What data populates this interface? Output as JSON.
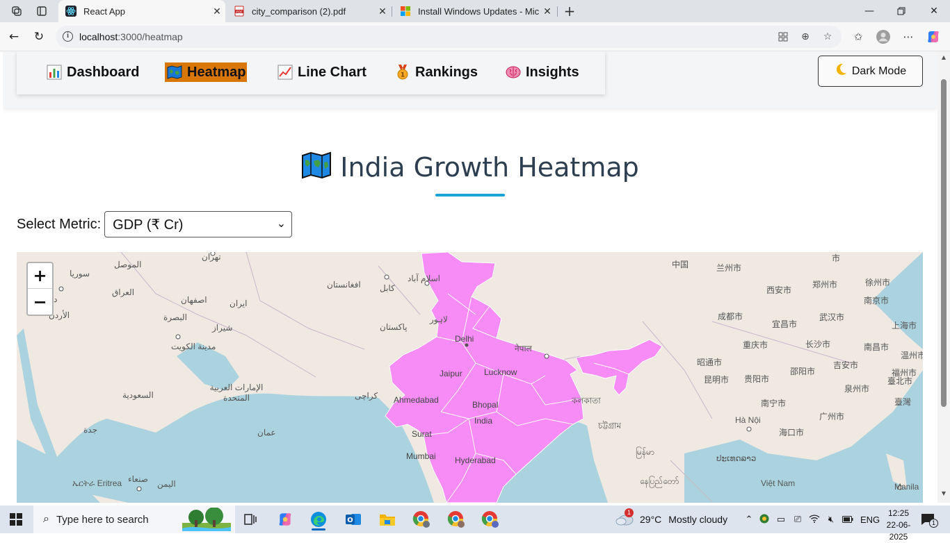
{
  "browser": {
    "tabs": [
      {
        "title": "React App",
        "active": true
      },
      {
        "title": "city_comparison (2).pdf",
        "active": false
      },
      {
        "title": "Install Windows Updates - Micros",
        "active": false
      }
    ],
    "url_host": "localhost",
    "url_path": ":3000/heatmap"
  },
  "nav": {
    "items": [
      {
        "label": "Dashboard",
        "icon": "bar-chart-icon"
      },
      {
        "label": "Heatmap",
        "icon": "map-icon"
      },
      {
        "label": "Line Chart",
        "icon": "line-chart-icon"
      },
      {
        "label": "Rankings",
        "icon": "medal-icon"
      },
      {
        "label": "Insights",
        "icon": "brain-icon"
      }
    ],
    "active_item": "Heatmap",
    "active_color": "#d97706",
    "dark_mode_label": "Dark Mode"
  },
  "page": {
    "title": "India Growth Heatmap",
    "accent_color": "#1aa3d6",
    "metric_label": "Select Metric:",
    "metric_selected": "GDP (₹ Cr)"
  },
  "map": {
    "highlight_color": "#f78cf7",
    "zoom_in": "+",
    "zoom_out": "−",
    "labels": {
      "mosul": "الموصل",
      "tehran": "تهران",
      "syria": "سوريا",
      "afghanistan": "افغانستان",
      "kabul": "كابل",
      "islamabad": "اسلام آباد",
      "iraq": "العراق",
      "isfahan": "اصفهان",
      "iran": "ايران",
      "damascus": "دمشق",
      "jordan": "الأردن",
      "basra": "البصرة",
      "lahore": "لاہور",
      "shiraz": "شیراز",
      "pakistan": "پاکستان",
      "kuwait": "مدينة الكويت",
      "uae": "الإمارات العربية المتحدة",
      "saudi": "السعودية",
      "karachi": "کراچی",
      "oman": "عمان",
      "jeddah": "جدة",
      "eritrea": "ኤርትራ Eritrea",
      "sanaa": "صنعاء",
      "yemen": "اليمن",
      "delhi": "Delhi",
      "jaipur": "Jaipur",
      "lucknow": "Lucknow",
      "nepal": "नेपाल",
      "ahmedabad": "Ahmedabad",
      "bhopal": "Bhopal",
      "india": "India",
      "surat": "Surat",
      "mumbai": "Mumbai",
      "hyderabad": "Hyderabad",
      "kolkata": "কলকাতা",
      "chittagong": "চট্টগ্রাম",
      "myanmar": "မြန်မာ",
      "nay_pyi_taw": "နေပြည်တော်",
      "china": "中国",
      "lanzhou": "兰州市",
      "xian": "西安市",
      "zhengzhou": "郑州市",
      "xuzhou": "徐州市",
      "nanjing": "南京市",
      "chengdu": "成都市",
      "yichang": "宜昌市",
      "wuhan": "武汉市",
      "shanghai": "上海市",
      "chongqing": "重庆市",
      "changsha": "长沙市",
      "nanchang": "南昌市",
      "wenzhou": "温州市",
      "zhaotong": "昭通市",
      "kunming": "昆明市",
      "guiyang": "贵阳市",
      "shaoyang": "邵阳市",
      "jian": "吉安市",
      "fuzhou": "福州市",
      "taipei": "臺北市",
      "quanzhou": "泉州市",
      "nanning": "南宁市",
      "guangzhou": "广州市",
      "taiwan": "臺灣",
      "hanoi": "Hà Nội",
      "haikou": "海口市",
      "laos": "ປະເທດລາວ",
      "vietnam": "Việt Nam",
      "manila": "Manila",
      "chhattisgarh_dup": "",
      "top_right": "市"
    }
  },
  "taskbar": {
    "search_placeholder": "Type here to search",
    "weather_temp": "29°C",
    "weather_text": "Mostly cloudy",
    "weather_badge": "1",
    "language": "ENG",
    "time": "12:25",
    "date": "22-06-2025",
    "notification_count": "1"
  }
}
